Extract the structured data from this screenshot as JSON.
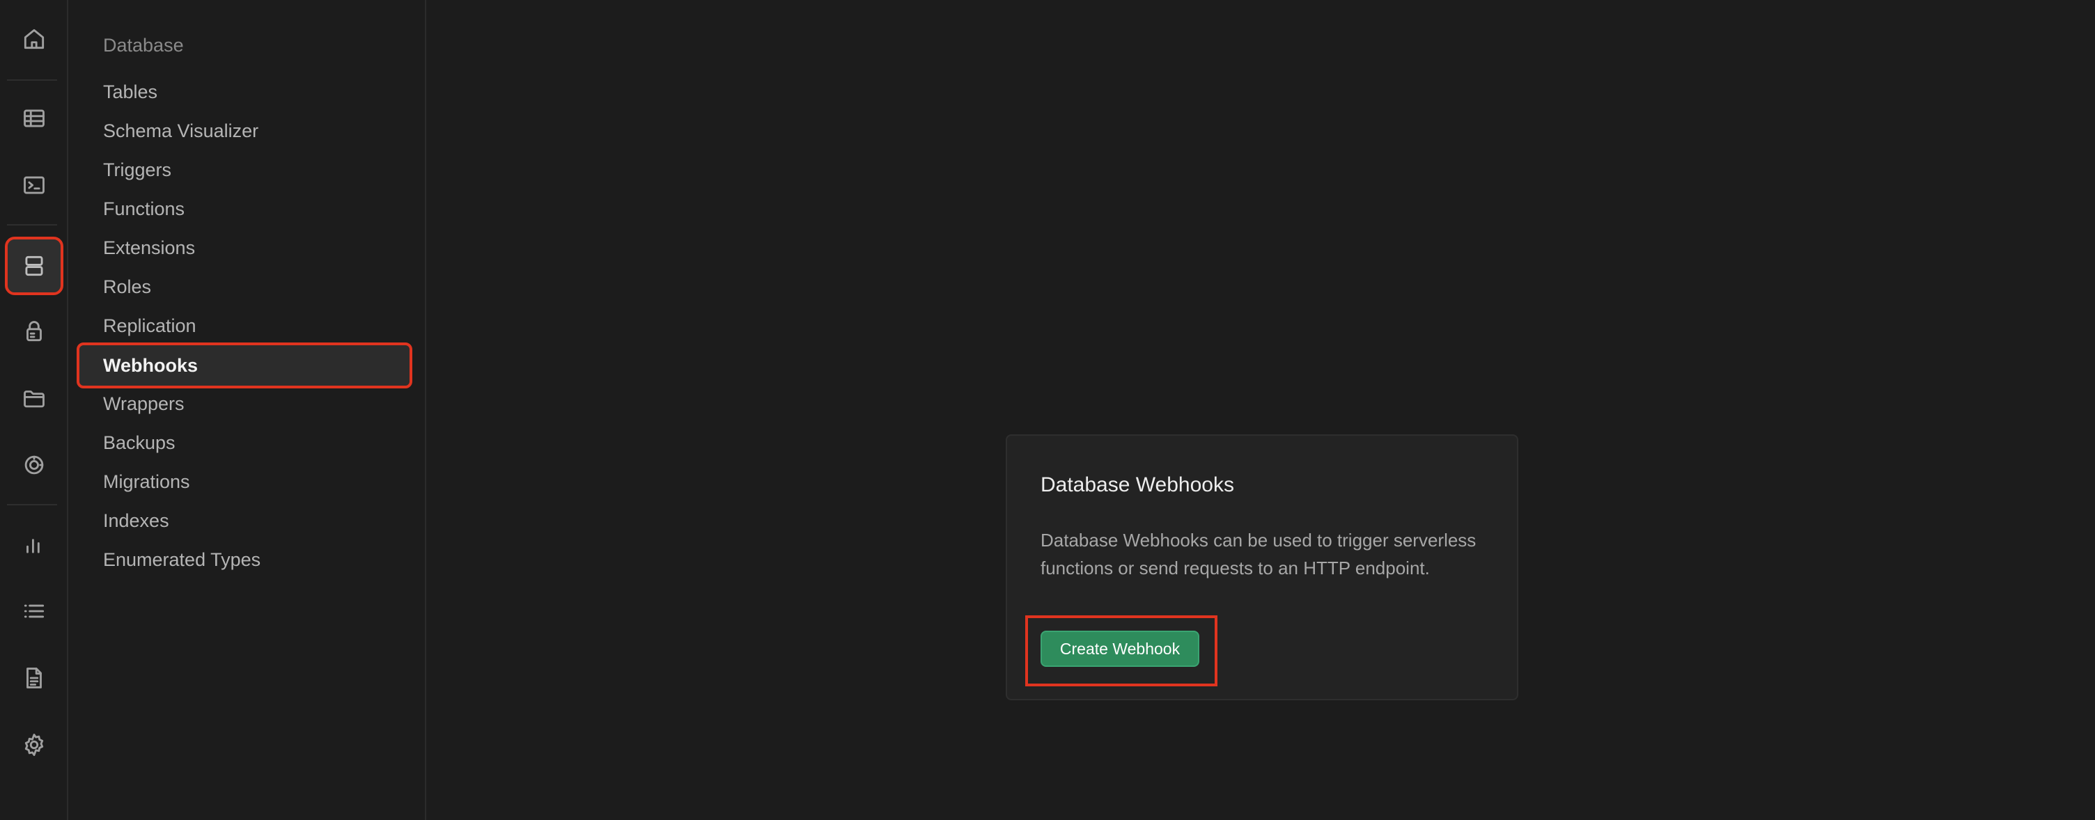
{
  "rail": {
    "icons": [
      "home-icon",
      "table-editor-icon",
      "sql-editor-icon",
      "database-icon",
      "authentication-icon",
      "storage-icon",
      "realtime-icon",
      "reports-icon",
      "logs-icon",
      "api-docs-icon",
      "settings-icon"
    ],
    "active": "database-icon"
  },
  "sidebar": {
    "heading": "Database",
    "items": [
      {
        "label": "Tables"
      },
      {
        "label": "Schema Visualizer"
      },
      {
        "label": "Triggers"
      },
      {
        "label": "Functions"
      },
      {
        "label": "Extensions"
      },
      {
        "label": "Roles"
      },
      {
        "label": "Replication"
      },
      {
        "label": "Webhooks",
        "active": true
      },
      {
        "label": "Wrappers"
      },
      {
        "label": "Backups"
      },
      {
        "label": "Migrations"
      },
      {
        "label": "Indexes"
      },
      {
        "label": "Enumerated Types"
      }
    ]
  },
  "card": {
    "title": "Database Webhooks",
    "description": "Database Webhooks can be used to trigger serverless functions or send requests to an HTTP endpoint.",
    "button_label": "Create Webhook"
  },
  "colors": {
    "background": "#1c1c1c",
    "highlight_outline": "#e0341f",
    "brand_green": "#2e8c5c"
  }
}
